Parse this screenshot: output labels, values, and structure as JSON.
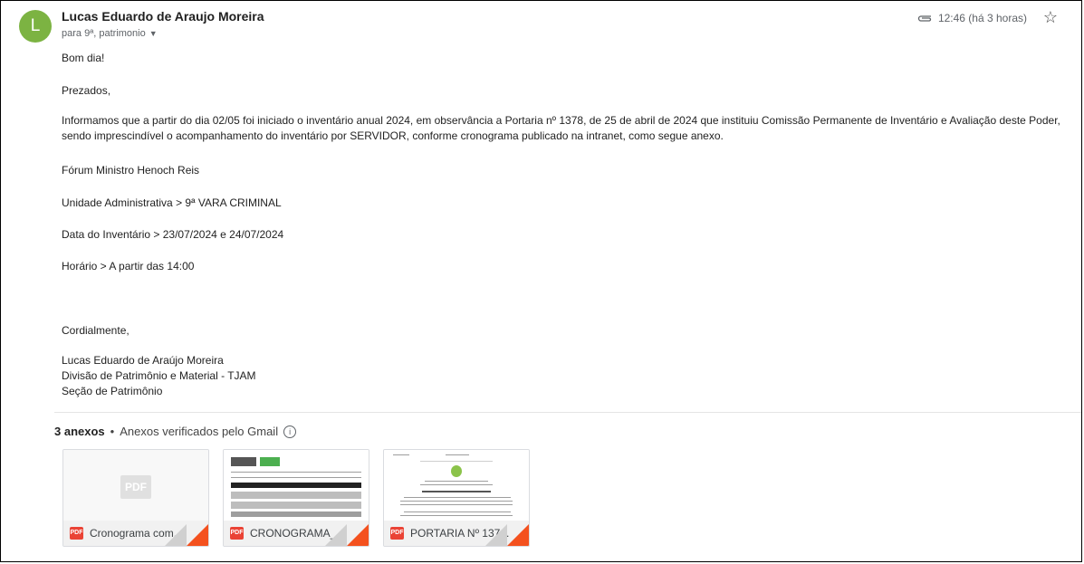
{
  "sender": {
    "avatar_letter": "L",
    "name": "Lucas Eduardo de Araujo Moreira",
    "recipients": "para 9ª, patrimonio"
  },
  "meta": {
    "time": "12:46 (há 3 horas)"
  },
  "message": {
    "p1": "Bom dia!",
    "p2": "Prezados,",
    "p3": "Informamos que a partir do dia 02/05 foi iniciado o inventário anual 2024, em observância a Portaria nº 1378, de 25 de abril de 2024 que instituiu Comissão Permanente de Inventário e Avaliação deste Poder, sendo imprescindível o acompanhamento do inventário por SERVIDOR, conforme cronograma publicado na intranet, como segue anexo.",
    "p4": "Fórum Ministro Henoch Reis",
    "p5": "Unidade Administrativa > 9ª VARA CRIMINAL",
    "p6": "Data do Inventário > 23/07/2024 e 24/07/2024",
    "p7": "Horário > A partir das 14:00",
    "p8": "Cordialmente,",
    "sig1": "Lucas Eduardo de Araújo Moreira",
    "sig2": "Divisão de Patrimônio e Material - TJAM",
    "sig3": "Seção de Patrimônio"
  },
  "attachments": {
    "count_label": "3 anexos",
    "separator": "•",
    "verified_label": "Anexos verificados pelo Gmail",
    "badge": "PDF",
    "files": [
      {
        "name": "Cronograma com..."
      },
      {
        "name": "CRONOGRAMA_..."
      },
      {
        "name": "PORTARIA Nº 137..."
      }
    ]
  },
  "colors": {
    "avatar": "#7cb342",
    "pdf_red": "#ea4335",
    "corner_orange": "#f4511e"
  }
}
